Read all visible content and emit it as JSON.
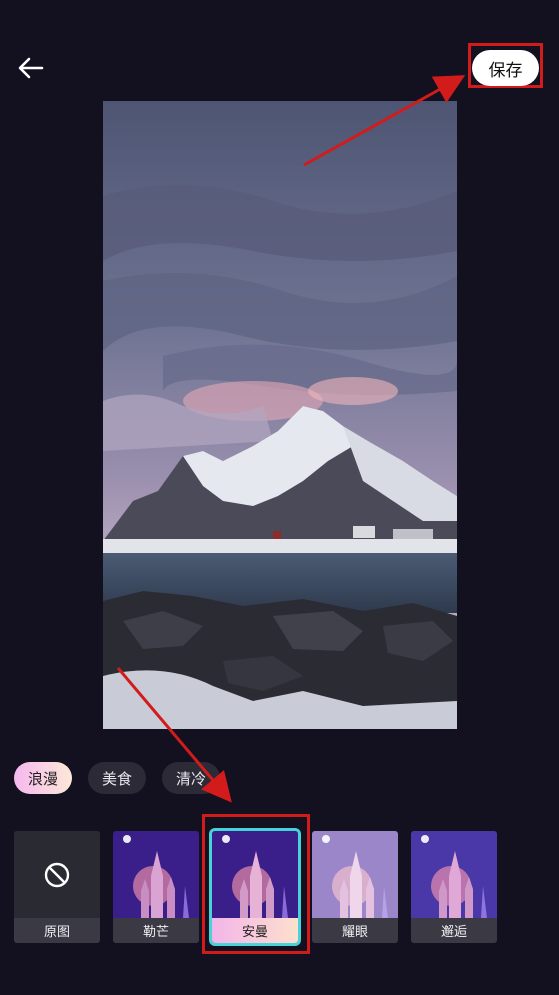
{
  "header": {
    "save_label": "保存"
  },
  "categories": [
    {
      "label": "浪漫",
      "active": true
    },
    {
      "label": "美食",
      "active": false
    },
    {
      "label": "清冷",
      "active": false
    }
  ],
  "filters": [
    {
      "label": "原图",
      "icon": "no-filter-icon",
      "active": false
    },
    {
      "label": "勒芒",
      "active": false
    },
    {
      "label": "安曼",
      "active": true
    },
    {
      "label": "耀眼",
      "active": false
    },
    {
      "label": "邂逅",
      "active": false
    }
  ],
  "colors": {
    "highlight": "#d21b1b",
    "active_outline": "#46d3d9",
    "background": "#13111f"
  }
}
